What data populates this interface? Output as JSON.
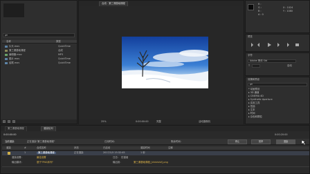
{
  "comp_tab": "合成：第三课基础课程",
  "project": {
    "search_placeholder": "ρ▾",
    "col_name": "名称",
    "col_type": "类型",
    "items": [
      {
        "name": "片头.mov",
        "type": "QuickTime"
      },
      {
        "name": "第三课基础课程",
        "type": "合成"
      },
      {
        "name": "编辑器.mov",
        "type": "MP3"
      },
      {
        "name": "图片.mov",
        "type": "QuickTime"
      },
      {
        "name": "结尾.mov",
        "type": "QuickTime"
      }
    ]
  },
  "info": {
    "r": "R :",
    "g": "G :",
    "b": "B :",
    "a": "A : 0",
    "x": "X : 1024",
    "y": "Y : 1080"
  },
  "preview": {
    "title": "预览"
  },
  "character": {
    "title": "字符",
    "font": "Adobe 黑体 Std",
    "size_label": "T",
    "leading": "自动"
  },
  "effects": {
    "title": "效果和预设",
    "search": "ρ▾",
    "items": [
      "* 动画预设",
      "▸ 3D 通道",
      "▸ CINEMA 4D",
      "▸ Synthetic Aperture",
      "▸ 实用工具",
      "▸ 扭曲",
      "▸ 文本",
      "▸ 时间",
      "▸ 杂色和颗粒"
    ]
  },
  "viewer": {
    "zoom": "25%",
    "timecode": "0:00:00:00",
    "resolution": "完整",
    "camera": "活动摄像机"
  },
  "timeline": {
    "tabs": [
      "第三课基础课程",
      "渲染队列"
    ],
    "timecode": "0:00:00:00",
    "current_render": "当前渲染",
    "status_line": "正在渲染\"第三课基础课程\"",
    "elapsed": "已用时间：",
    "remaining": "剩余时间：",
    "stop": "停止",
    "pause": "暂停",
    "render": "渲染",
    "queue_cols": [
      "渲染",
      "#",
      "合成名称",
      "状态",
      "已启动",
      "渲染时间",
      "注释"
    ],
    "queue_row": {
      "num": "1",
      "comp": "第三课基础课程",
      "status": "正在渲染",
      "started": "2017/1/5 15:32:45",
      "time": "1 秒"
    },
    "render_settings_label": "渲染设置：",
    "render_settings_value": "最佳设置",
    "output_module_label": "输出模块：",
    "output_module_value": "基于\"PNG序列\"",
    "log_label": "日志：",
    "log_value": "仅错误",
    "output_to_label": "输出到：",
    "output_to_value": "第三课基础课程_[#####].png",
    "total_time": "0:00:20:00"
  }
}
